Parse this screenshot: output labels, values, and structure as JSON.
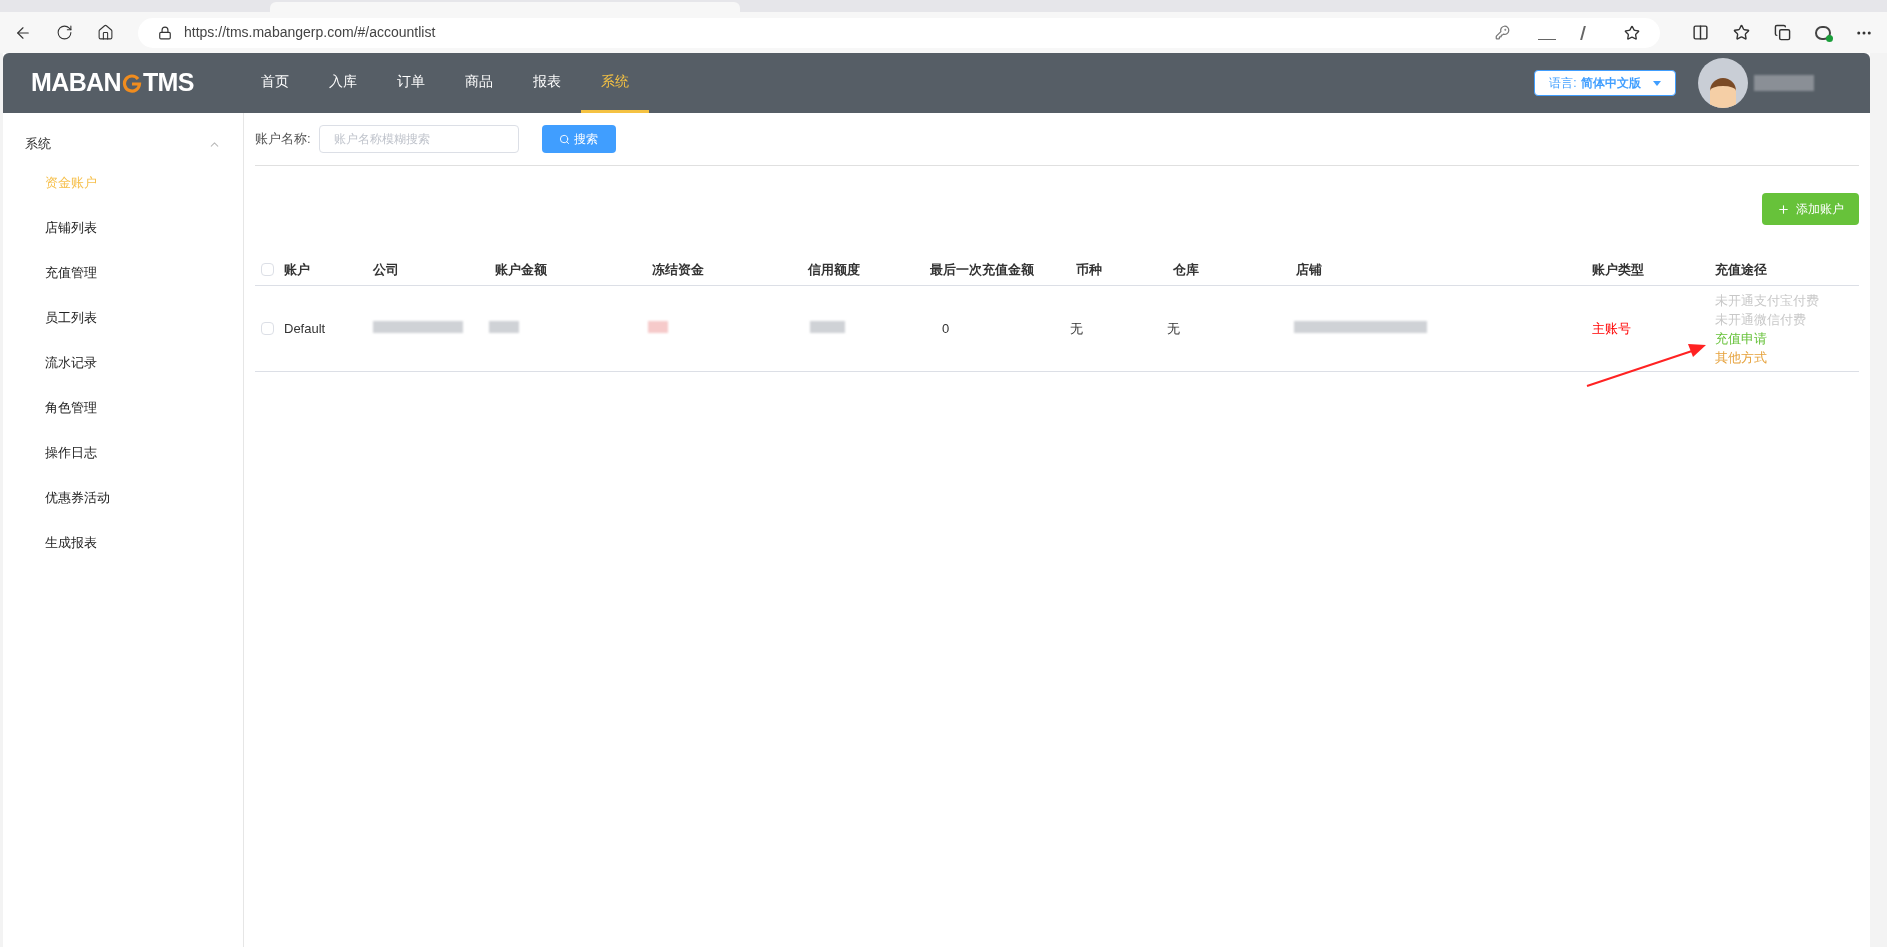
{
  "browser": {
    "url": "https://tms.mabangerp.com/#/accountlist"
  },
  "header": {
    "logo_left": "MABAN",
    "logo_right": "TMS",
    "nav": [
      {
        "label": "首页",
        "selected": false
      },
      {
        "label": "入库",
        "selected": false
      },
      {
        "label": "订单",
        "selected": false
      },
      {
        "label": "商品",
        "selected": false
      },
      {
        "label": "报表",
        "selected": false
      },
      {
        "label": "系统",
        "selected": true
      }
    ],
    "language": {
      "label": "语言:",
      "value": "简体中文版"
    }
  },
  "sidebar": {
    "group": {
      "label": "系统",
      "expanded": true
    },
    "items": [
      {
        "label": "资金账户",
        "selected": true
      },
      {
        "label": "店铺列表",
        "selected": false
      },
      {
        "label": "充值管理",
        "selected": false
      },
      {
        "label": "员工列表",
        "selected": false
      },
      {
        "label": "流水记录",
        "selected": false
      },
      {
        "label": "角色管理",
        "selected": false
      },
      {
        "label": "操作日志",
        "selected": false
      },
      {
        "label": "优惠券活动",
        "selected": false
      },
      {
        "label": "生成报表",
        "selected": false
      }
    ]
  },
  "search": {
    "label": "账户名称:",
    "placeholder": "账户名称模糊搜索",
    "button": "搜索"
  },
  "add_button": "添加账户",
  "table": {
    "select_all_checked": false,
    "columns": [
      "账户",
      "公司",
      "账户金额",
      "冻结资金",
      "信用额度",
      "最后一次充值金额",
      "币种",
      "仓库",
      "店铺",
      "账户类型",
      "充值途径"
    ],
    "rows": [
      {
        "checked": false,
        "account": "Default",
        "last_recharge": "0",
        "currency": "无",
        "warehouse": "无",
        "account_type": "主账号",
        "recharge_options": [
          {
            "label": "未开通支付宝付费",
            "color": "#c8c8c8"
          },
          {
            "label": "未开通微信付费",
            "color": "#c8c8c8"
          },
          {
            "label": "充值申请",
            "color": "#67c23a"
          },
          {
            "label": "其他方式",
            "color": "#e6a23c"
          }
        ]
      }
    ]
  }
}
